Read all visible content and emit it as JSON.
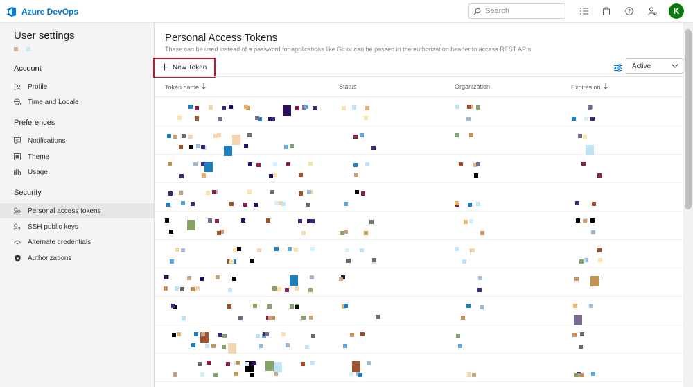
{
  "app": {
    "name": "Azure DevOps",
    "avatar_initial": "K",
    "brand_color": "#0078d4",
    "avatar_color": "#0b7a0b"
  },
  "search": {
    "placeholder": "Search"
  },
  "toolbar_icons": [
    "list-icon",
    "marketplace-bag-icon",
    "help-icon",
    "user-settings-icon"
  ],
  "sidebar": {
    "title": "User settings",
    "sections": [
      {
        "label": "Account",
        "items": [
          {
            "label": "Profile",
            "icon": "profile-icon"
          },
          {
            "label": "Time and Locale",
            "icon": "globe-icon"
          }
        ]
      },
      {
        "label": "Preferences",
        "items": [
          {
            "label": "Notifications",
            "icon": "notifications-icon"
          },
          {
            "label": "Theme",
            "icon": "theme-icon"
          },
          {
            "label": "Usage",
            "icon": "usage-icon"
          }
        ]
      },
      {
        "label": "Security",
        "items": [
          {
            "label": "Personal access tokens",
            "icon": "token-icon",
            "selected": true
          },
          {
            "label": "SSH public keys",
            "icon": "key-icon"
          },
          {
            "label": "Alternate credentials",
            "icon": "credentials-icon"
          },
          {
            "label": "Authorizations",
            "icon": "shield-icon"
          }
        ]
      }
    ]
  },
  "main": {
    "title": "Personal Access Tokens",
    "description": "These can be used instead of a password for applications like Git or can be passed in the authorization header to access REST APIs",
    "new_token_label": "New Token",
    "state_filter": "Active",
    "columns": [
      {
        "label": "Token name",
        "sort": "down"
      },
      {
        "label": "Status"
      },
      {
        "label": "Organization"
      },
      {
        "label": "Expires on",
        "sort": "down"
      }
    ]
  }
}
